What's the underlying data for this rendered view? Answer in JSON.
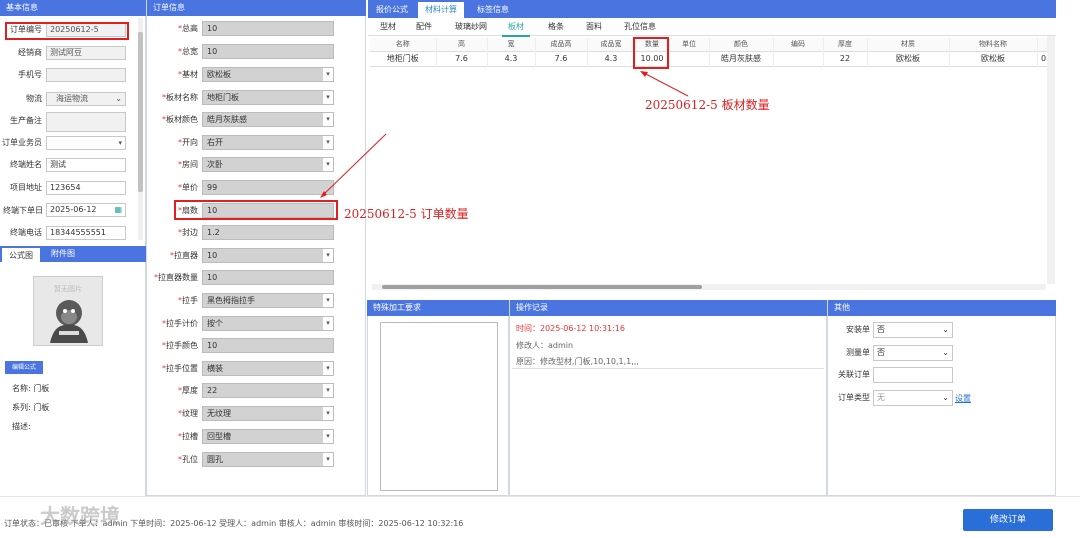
{
  "left": {
    "header": "基本信息",
    "order_no_label": "订单编号",
    "order_no": "20250612-5",
    "dealer_label": "经销商",
    "dealer": "测试阿豆",
    "phone_label": "手机号",
    "phone": "",
    "logistics_label": "物流",
    "logistics": "海运物流",
    "note_label": "生产备注",
    "salesman_label": "订单业务员",
    "terminal_name_label": "终端姓名",
    "terminal_name": "测试",
    "address_label": "项目地址",
    "address": "123654",
    "order_date_label": "终端下单日",
    "order_date": "2025-06-12",
    "terminal_phone_label": "终端电话",
    "terminal_phone": "18344555551",
    "tabs": [
      "公式图",
      "附件图"
    ],
    "no_image": "暂无图片",
    "edit_formula": "编辑公式",
    "name_label": "名称:",
    "name": "门板",
    "series_label": "系列:",
    "series": "门板",
    "desc_label": "描述:"
  },
  "mid": {
    "header": "订单信息",
    "fields": [
      {
        "label": "总高",
        "value": "10",
        "sel": false
      },
      {
        "label": "总宽",
        "value": "10",
        "sel": false
      },
      {
        "label": "基材",
        "value": "欧松板",
        "sel": true
      },
      {
        "label": "板材名称",
        "value": "地柜门板",
        "sel": true
      },
      {
        "label": "板材颜色",
        "value": "皓月灰肤感",
        "sel": true
      },
      {
        "label": "开向",
        "value": "右开",
        "sel": true
      },
      {
        "label": "房间",
        "value": "次卧",
        "sel": true
      },
      {
        "label": "单价",
        "value": "99",
        "sel": false
      },
      {
        "label": "扇数",
        "value": "10",
        "sel": false
      },
      {
        "label": "封边",
        "value": "1.2",
        "sel": false
      },
      {
        "label": "拉直器",
        "value": "10",
        "sel": true
      },
      {
        "label": "拉直器数量",
        "value": "10",
        "sel": false
      },
      {
        "label": "拉手",
        "value": "黑色拇指拉手",
        "sel": true
      },
      {
        "label": "拉手计价",
        "value": "按个",
        "sel": true
      },
      {
        "label": "拉手颜色",
        "value": "10",
        "sel": false
      },
      {
        "label": "拉手位置",
        "value": "横装",
        "sel": true
      },
      {
        "label": "厚度",
        "value": "22",
        "sel": true
      },
      {
        "label": "纹理",
        "value": "无纹理",
        "sel": true
      },
      {
        "label": "拉槽",
        "value": "回型槽",
        "sel": true
      },
      {
        "label": "孔位",
        "value": "圆孔",
        "sel": true
      }
    ]
  },
  "right": {
    "top_tabs": [
      "报价公式",
      "材料计算",
      "标签信息"
    ],
    "sub_tabs": [
      "型材",
      "配件",
      "玻璃纱网",
      "板材",
      "格条",
      "面料",
      "孔位信息"
    ],
    "columns": [
      "名称",
      "高",
      "宽",
      "成品高",
      "成品宽",
      "数量",
      "单位",
      "颜色",
      "编码",
      "厚度",
      "材质",
      "物料名称",
      ""
    ],
    "row": [
      "地柜门板",
      "7.6",
      "4.3",
      "7.6",
      "4.3",
      "10.00",
      "",
      "皓月灰肤感",
      "",
      "22",
      "欧松板",
      "欧松板",
      "0"
    ]
  },
  "bottom": {
    "special_header": "特殊加工要求",
    "log_header": "操作记录",
    "log_time": "时间：2025-06-12 10:31:16",
    "log_user": "修改人：admin",
    "log_reason": "原因：修改型材,门板,10,10,1,1,,,",
    "other_header": "其他",
    "install_label": "安装单",
    "install": "否",
    "measure_label": "测量单",
    "measure": "否",
    "related_label": "关联订单",
    "type_label": "订单类型",
    "type_value": "无",
    "settings": "设置"
  },
  "footer": {
    "status": "订单状态：已审核  下单人：admin  下单时间：2025-06-12  受理人：admin  审核人：admin  审核时间：2025-06-12 10:32:16",
    "submit": "修改订单",
    "watermark": "大数跨境"
  },
  "annotations": {
    "qty_table": "20250612-5  板材数量",
    "qty_order": "20250612-5  订单数量"
  }
}
